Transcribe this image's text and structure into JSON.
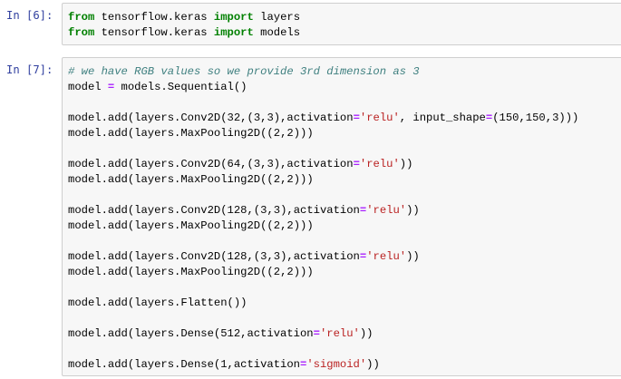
{
  "cells": [
    {
      "prompt": "In [6]:",
      "lines": [
        [
          {
            "t": "from",
            "c": "kw"
          },
          {
            "t": " tensorflow.keras ",
            "c": ""
          },
          {
            "t": "import",
            "c": "kw"
          },
          {
            "t": " layers",
            "c": ""
          }
        ],
        [
          {
            "t": "from",
            "c": "kw"
          },
          {
            "t": " tensorflow.keras ",
            "c": ""
          },
          {
            "t": "import",
            "c": "kw"
          },
          {
            "t": " models",
            "c": ""
          }
        ]
      ]
    },
    {
      "prompt": "In [7]:",
      "lines": [
        [
          {
            "t": "# we have RGB values so we provide 3rd dimension as 3",
            "c": "cm"
          }
        ],
        [
          {
            "t": "model ",
            "c": ""
          },
          {
            "t": "=",
            "c": "op"
          },
          {
            "t": " models.Sequential()",
            "c": ""
          }
        ],
        [],
        [
          {
            "t": "model.add(layers.Conv2D(",
            "c": ""
          },
          {
            "t": "32",
            "c": "nm"
          },
          {
            "t": ",(",
            "c": ""
          },
          {
            "t": "3",
            "c": "nm"
          },
          {
            "t": ",",
            "c": ""
          },
          {
            "t": "3",
            "c": "nm"
          },
          {
            "t": "),activation",
            "c": ""
          },
          {
            "t": "=",
            "c": "op"
          },
          {
            "t": "'relu'",
            "c": "st"
          },
          {
            "t": ", input_shape",
            "c": ""
          },
          {
            "t": "=",
            "c": "op"
          },
          {
            "t": "(",
            "c": ""
          },
          {
            "t": "150",
            "c": "nm"
          },
          {
            "t": ",",
            "c": ""
          },
          {
            "t": "150",
            "c": "nm"
          },
          {
            "t": ",",
            "c": ""
          },
          {
            "t": "3",
            "c": "nm"
          },
          {
            "t": ")))",
            "c": ""
          }
        ],
        [
          {
            "t": "model.add(layers.MaxPooling2D((",
            "c": ""
          },
          {
            "t": "2",
            "c": "nm"
          },
          {
            "t": ",",
            "c": ""
          },
          {
            "t": "2",
            "c": "nm"
          },
          {
            "t": ")))",
            "c": ""
          }
        ],
        [],
        [
          {
            "t": "model.add(layers.Conv2D(",
            "c": ""
          },
          {
            "t": "64",
            "c": "nm"
          },
          {
            "t": ",(",
            "c": ""
          },
          {
            "t": "3",
            "c": "nm"
          },
          {
            "t": ",",
            "c": ""
          },
          {
            "t": "3",
            "c": "nm"
          },
          {
            "t": "),activation",
            "c": ""
          },
          {
            "t": "=",
            "c": "op"
          },
          {
            "t": "'relu'",
            "c": "st"
          },
          {
            "t": "))",
            "c": ""
          }
        ],
        [
          {
            "t": "model.add(layers.MaxPooling2D((",
            "c": ""
          },
          {
            "t": "2",
            "c": "nm"
          },
          {
            "t": ",",
            "c": ""
          },
          {
            "t": "2",
            "c": "nm"
          },
          {
            "t": ")))",
            "c": ""
          }
        ],
        [],
        [
          {
            "t": "model.add(layers.Conv2D(",
            "c": ""
          },
          {
            "t": "128",
            "c": "nm"
          },
          {
            "t": ",(",
            "c": ""
          },
          {
            "t": "3",
            "c": "nm"
          },
          {
            "t": ",",
            "c": ""
          },
          {
            "t": "3",
            "c": "nm"
          },
          {
            "t": "),activation",
            "c": ""
          },
          {
            "t": "=",
            "c": "op"
          },
          {
            "t": "'relu'",
            "c": "st"
          },
          {
            "t": "))",
            "c": ""
          }
        ],
        [
          {
            "t": "model.add(layers.MaxPooling2D((",
            "c": ""
          },
          {
            "t": "2",
            "c": "nm"
          },
          {
            "t": ",",
            "c": ""
          },
          {
            "t": "2",
            "c": "nm"
          },
          {
            "t": ")))",
            "c": ""
          }
        ],
        [],
        [
          {
            "t": "model.add(layers.Conv2D(",
            "c": ""
          },
          {
            "t": "128",
            "c": "nm"
          },
          {
            "t": ",(",
            "c": ""
          },
          {
            "t": "3",
            "c": "nm"
          },
          {
            "t": ",",
            "c": ""
          },
          {
            "t": "3",
            "c": "nm"
          },
          {
            "t": "),activation",
            "c": ""
          },
          {
            "t": "=",
            "c": "op"
          },
          {
            "t": "'relu'",
            "c": "st"
          },
          {
            "t": "))",
            "c": ""
          }
        ],
        [
          {
            "t": "model.add(layers.MaxPooling2D((",
            "c": ""
          },
          {
            "t": "2",
            "c": "nm"
          },
          {
            "t": ",",
            "c": ""
          },
          {
            "t": "2",
            "c": "nm"
          },
          {
            "t": ")))",
            "c": ""
          }
        ],
        [],
        [
          {
            "t": "model.add(layers.Flatten())",
            "c": ""
          }
        ],
        [],
        [
          {
            "t": "model.add(layers.Dense(",
            "c": ""
          },
          {
            "t": "512",
            "c": "nm"
          },
          {
            "t": ",activation",
            "c": ""
          },
          {
            "t": "=",
            "c": "op"
          },
          {
            "t": "'relu'",
            "c": "st"
          },
          {
            "t": "))",
            "c": ""
          }
        ],
        [],
        [
          {
            "t": "model.add(layers.Dense(",
            "c": ""
          },
          {
            "t": "1",
            "c": "nm"
          },
          {
            "t": ",activation",
            "c": ""
          },
          {
            "t": "=",
            "c": "op"
          },
          {
            "t": "'sigmoid'",
            "c": "st"
          },
          {
            "t": "))",
            "c": ""
          }
        ]
      ]
    }
  ],
  "colors": {
    "prompt": "#303f9f",
    "keyword": "#008000",
    "comment": "#408080",
    "operator": "#aa22ff",
    "string": "#ba2121",
    "cell_background": "#f7f7f7",
    "cell_border": "#cfcfcf"
  }
}
